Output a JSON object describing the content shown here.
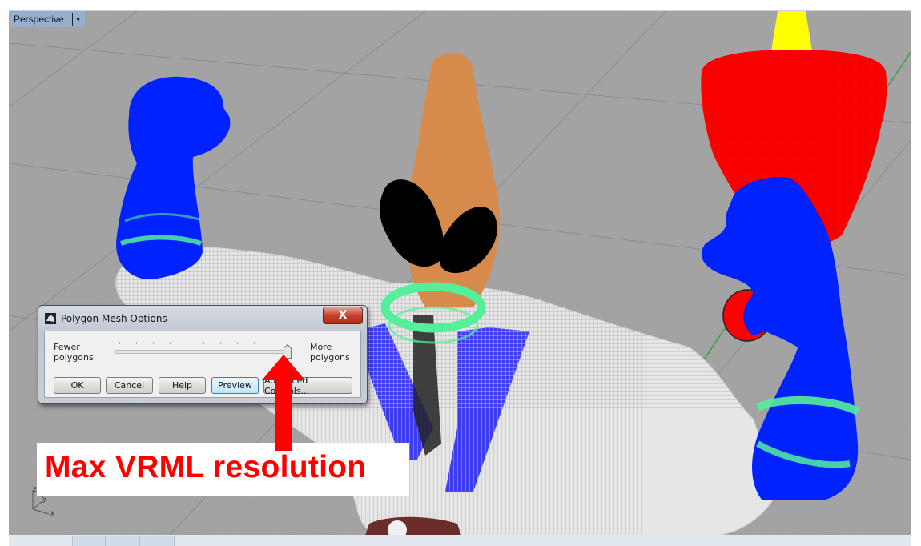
{
  "viewport": {
    "label": "Perspective",
    "menu_icon": "dropdown-caret-icon",
    "background_color": "#a3a3a3",
    "axis_indicator": {
      "x": "x",
      "y": "y",
      "z": "z"
    }
  },
  "scene": {
    "objects": [
      {
        "name": "left-arm",
        "color": "#0022ff"
      },
      {
        "name": "right-arm",
        "color": "#0022ff"
      },
      {
        "name": "wrist-bands",
        "color": "#55ee99"
      },
      {
        "name": "neck-ring",
        "color": "#55ee99"
      },
      {
        "name": "head",
        "color": "#d68a4c"
      },
      {
        "name": "mask",
        "color": "#000000"
      },
      {
        "name": "cup",
        "color": "#ff0000"
      },
      {
        "name": "cup-top",
        "color": "#ffff00"
      },
      {
        "name": "torso-wireframe",
        "color": "#e8e8e8"
      }
    ]
  },
  "dialog": {
    "title": "Polygon Mesh Options",
    "close_label": "X",
    "slider": {
      "left_label_line1": "Fewer",
      "left_label_line2": "polygons",
      "right_label_line1": "More",
      "right_label_line2": "polygons",
      "tick_count": 11,
      "value_fraction": 1.0
    },
    "buttons": {
      "ok": "OK",
      "cancel": "Cancel",
      "help": "Help",
      "preview": "Preview",
      "advanced": "Advanced Controls..."
    }
  },
  "annotation": {
    "text": "Max VRML resolution",
    "color": "#ff0000"
  }
}
